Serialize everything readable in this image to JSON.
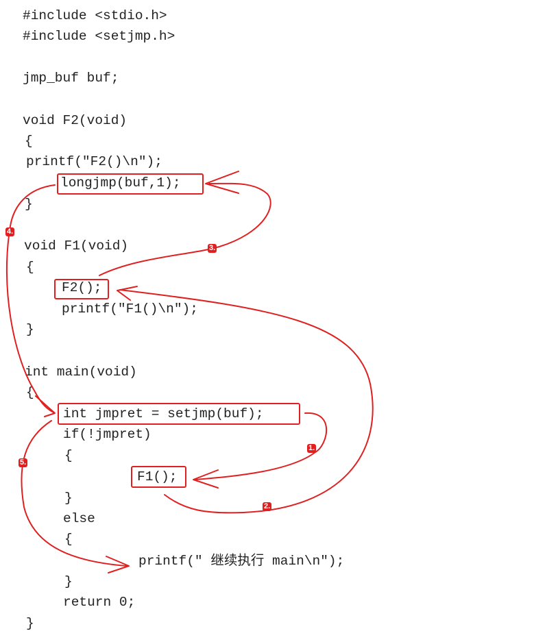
{
  "code": [
    "#include <stdio.h>",
    "#include <setjmp.h>",
    "",
    "jmp_buf buf;",
    "",
    "void F2(void)",
    "{",
    "    printf(\"F2()\\n\");",
    "    longjmp(buf,1);",
    "}",
    "",
    "void F1(void)",
    "{",
    "    F2();",
    "    printf(\"F1()\\n\");",
    "}",
    "",
    "int main(void)",
    "{",
    "    int jmpret = setjmp(buf);",
    "    if(!jmpret)",
    "    {",
    "            F1();",
    "    }",
    "    else",
    "    {",
    "        printf(\" 继续执行 main\\n\");",
    "    }",
    "    return 0;",
    "}"
  ],
  "highlights": [
    "longjmp(buf,1);",
    "F2();",
    "int jmpret = setjmp(buf);",
    "F1();"
  ],
  "steps": [
    "1.",
    "2.",
    "3.",
    "4.",
    "5."
  ],
  "colors": {
    "accent": "#e02020",
    "code_text": "#222222",
    "background": "#ffffff"
  }
}
